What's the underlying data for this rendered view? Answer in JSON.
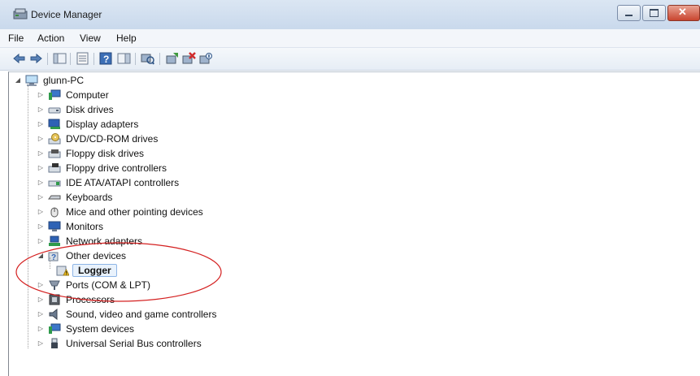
{
  "window": {
    "title": "Device Manager"
  },
  "menu": [
    "File",
    "Action",
    "View",
    "Help"
  ],
  "toolbar": {
    "buttons": [
      "back-icon",
      "forward-icon",
      "show-hide-console-tree-icon",
      "properties-icon",
      "help-icon",
      "action-pane-icon",
      "scan-hardware-changes-icon",
      "update-driver-icon",
      "uninstall-icon",
      "disable-icon"
    ]
  },
  "tree": {
    "root": "glunn-PC",
    "categories": [
      {
        "label": "Computer",
        "icon": "computer-icon",
        "expanded": false
      },
      {
        "label": "Disk drives",
        "icon": "disk-drive-icon",
        "expanded": false
      },
      {
        "label": "Display adapters",
        "icon": "display-adapter-icon",
        "expanded": false
      },
      {
        "label": "DVD/CD-ROM drives",
        "icon": "dvd-drive-icon",
        "expanded": false
      },
      {
        "label": "Floppy disk drives",
        "icon": "floppy-drive-icon",
        "expanded": false
      },
      {
        "label": "Floppy drive controllers",
        "icon": "floppy-controller-icon",
        "expanded": false
      },
      {
        "label": "IDE ATA/ATAPI controllers",
        "icon": "ide-controller-icon",
        "expanded": false
      },
      {
        "label": "Keyboards",
        "icon": "keyboard-icon",
        "expanded": false
      },
      {
        "label": "Mice and other pointing devices",
        "icon": "mouse-icon",
        "expanded": false
      },
      {
        "label": "Monitors",
        "icon": "monitor-icon",
        "expanded": false
      },
      {
        "label": "Network adapters",
        "icon": "network-adapter-icon",
        "expanded": false
      },
      {
        "label": "Other devices",
        "icon": "other-devices-icon",
        "expanded": true,
        "children": [
          {
            "label": "Logger",
            "icon": "warning-device-icon",
            "selected": true
          }
        ]
      },
      {
        "label": "Ports (COM & LPT)",
        "icon": "port-icon",
        "expanded": false
      },
      {
        "label": "Processors",
        "icon": "processor-icon",
        "expanded": false
      },
      {
        "label": "Sound, video and game controllers",
        "icon": "sound-icon",
        "expanded": false
      },
      {
        "label": "System devices",
        "icon": "system-devices-icon",
        "expanded": false
      },
      {
        "label": "Universal Serial Bus controllers",
        "icon": "usb-icon",
        "expanded": false
      }
    ]
  },
  "colors": {
    "annotation": "#d42020",
    "selection": "#e9f2fc",
    "titlebar": "#c9d9ec"
  }
}
